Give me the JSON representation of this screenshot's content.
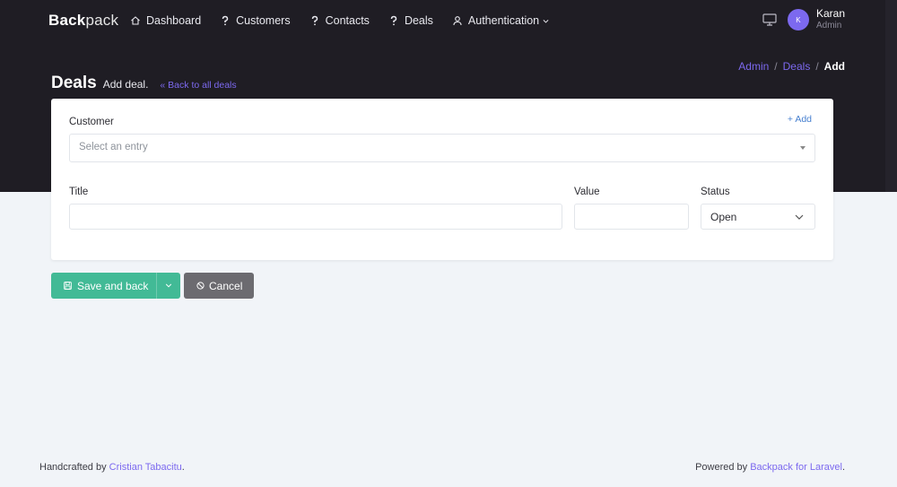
{
  "nav": {
    "brand_bold": "Back",
    "brand_rest": "pack",
    "items": [
      {
        "label": "Dashboard",
        "icon": "home-icon"
      },
      {
        "label": "Customers",
        "icon": "question-icon"
      },
      {
        "label": "Contacts",
        "icon": "question-icon"
      },
      {
        "label": "Deals",
        "icon": "question-icon"
      },
      {
        "label": "Authentication",
        "icon": "user-icon"
      }
    ],
    "user": {
      "initial": "K",
      "name": "Karan",
      "role": "Admin"
    }
  },
  "breadcrumb": {
    "items": [
      "Admin",
      "Deals"
    ],
    "active": "Add",
    "separator": "/"
  },
  "header": {
    "title": "Deals",
    "subtitle": "Add deal.",
    "back_link": "« Back to all deals"
  },
  "form": {
    "customer_label": "Customer",
    "add_link": "+ Add",
    "customer_placeholder": "Select an entry",
    "title_label": "Title",
    "title_value": "",
    "value_label": "Value",
    "value_value": "",
    "status_label": "Status",
    "status_value": "Open"
  },
  "actions": {
    "save_label": "Save and back",
    "cancel_label": "Cancel"
  },
  "footer": {
    "left_prefix": "Handcrafted by ",
    "left_link": "Cristian Tabacitu",
    "left_suffix": ".",
    "right_prefix": "Powered by ",
    "right_link": "Backpack for Laravel",
    "right_suffix": "."
  },
  "colors": {
    "accent": "#7c69ef",
    "dark_band": "#1f1d24",
    "success": "#42ba96",
    "secondary": "#6c6b70",
    "page_bg": "#f1f4f8"
  }
}
